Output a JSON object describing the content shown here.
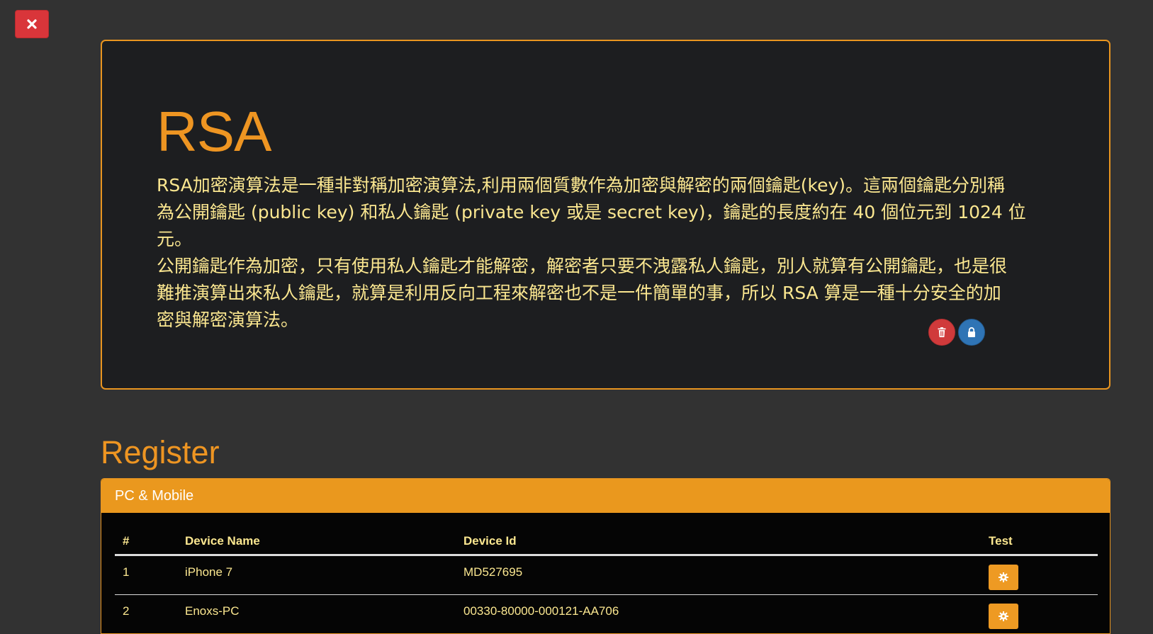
{
  "close_button": {
    "icon": "close-icon",
    "color": "#d9353a"
  },
  "rsa": {
    "title": "RSA",
    "description": "RSA加密演算法是一種非對稱加密演算法,利用兩個質數作為加密與解密的兩個鑰匙(key)。這兩個鑰匙分別稱\n為公開鑰匙 (public key) 和私人鑰匙 (private key 或是 secret key)，鑰匙的長度約在 40 個位元到 1024 位元。\n公開鑰匙作為加密，只有使用私人鑰匙才能解密，解密者只要不洩露私人鑰匙，別人就算有公開鑰匙，也是很\n難推演算出來私人鑰匙，就算是利用反向工程來解密也不是一件簡單的事，所以 RSA 算是一種十分安全的加\n密與解密演算法。",
    "delete_icon": "trash-icon",
    "lock_icon": "lock-icon"
  },
  "register": {
    "title": "Register",
    "panel_heading": "PC & Mobile",
    "columns": [
      "#",
      "Device Name",
      "Device Id",
      "Test"
    ],
    "rows": [
      {
        "num": "1",
        "name": "iPhone 7",
        "id": "MD527695"
      },
      {
        "num": "2",
        "name": "Enoxs-PC",
        "id": "00330-80000-000121-AA706"
      }
    ],
    "test_icon": "gear-icon"
  },
  "colors": {
    "accent": "#ee9522",
    "text": "#fbe790",
    "background": "#323232",
    "panel": "#1d1e20"
  }
}
